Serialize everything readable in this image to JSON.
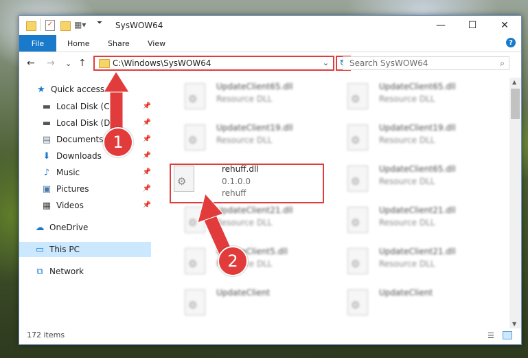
{
  "window": {
    "title": "SysWOW64",
    "minimize_glyph": "—",
    "maximize_glyph": "☐",
    "close_glyph": "✕"
  },
  "ribbon": {
    "file": "File",
    "tabs": [
      "Home",
      "Share",
      "View"
    ],
    "help_glyph": "?"
  },
  "nav": {
    "back_glyph": "←",
    "forward_glyph": "→",
    "recent_glyph": "⌄",
    "up_glyph": "↑",
    "address": "C:\\Windows\\SysWOW64",
    "address_chevron": "⌄",
    "refresh_glyph": "↻",
    "search_placeholder": "Search SysWOW64",
    "search_glyph": "⌕"
  },
  "sidebar": {
    "items": [
      {
        "label": "Quick access",
        "icon": "star-icon",
        "glyph": "★",
        "color": "#1979ca",
        "pinned": false
      },
      {
        "label": "Local Disk (C:)",
        "icon": "drive-icon",
        "glyph": "▬",
        "color": "#555555",
        "pinned": true
      },
      {
        "label": "Local Disk (D:)",
        "icon": "drive-icon",
        "glyph": "▬",
        "color": "#555555",
        "pinned": true
      },
      {
        "label": "Documents",
        "icon": "documents-icon",
        "glyph": "▤",
        "color": "#6b7b8c",
        "pinned": true
      },
      {
        "label": "Downloads",
        "icon": "downloads-icon",
        "glyph": "⬇",
        "color": "#1979ca",
        "pinned": true
      },
      {
        "label": "Music",
        "icon": "music-icon",
        "glyph": "♪",
        "color": "#1979ca",
        "pinned": true
      },
      {
        "label": "Pictures",
        "icon": "pictures-icon",
        "glyph": "▣",
        "color": "#4a7aa8",
        "pinned": true
      },
      {
        "label": "Videos",
        "icon": "videos-icon",
        "glyph": "▦",
        "color": "#444444",
        "pinned": true
      },
      {
        "label": "OneDrive",
        "icon": "onedrive-icon",
        "glyph": "☁",
        "color": "#1979ca",
        "pinned": false
      },
      {
        "label": "This PC",
        "icon": "this-pc-icon",
        "glyph": "▭",
        "color": "#1979ca",
        "pinned": false
      },
      {
        "label": "Network",
        "icon": "network-icon",
        "glyph": "⧉",
        "color": "#1979ca",
        "pinned": false
      }
    ],
    "pin_glyph": "📌"
  },
  "files": [
    {
      "name": "UpdateClient65.dll",
      "desc": "Resource DLL",
      "sub": ""
    },
    {
      "name": "UpdateClient65.dll",
      "desc": "Resource DLL",
      "sub": ""
    },
    {
      "name": "UpdateClient19.dll",
      "desc": "Resource DLL",
      "sub": ""
    },
    {
      "name": "UpdateClient19.dll",
      "desc": "Resource DLL",
      "sub": ""
    },
    {
      "name": "rehuff.dll",
      "desc": "0.1.0.0",
      "sub": "rehuff"
    },
    {
      "name": "UpdateClient65.dll",
      "desc": "Resource DLL",
      "sub": ""
    },
    {
      "name": "UpdateClient21.dll",
      "desc": "Resource DLL",
      "sub": ""
    },
    {
      "name": "UpdateClient21.dll",
      "desc": "Resource DLL",
      "sub": ""
    },
    {
      "name": "UpdateClient5.dll",
      "desc": "Resource DLL",
      "sub": ""
    },
    {
      "name": "UpdateClient21.dll",
      "desc": "Resource DLL",
      "sub": ""
    },
    {
      "name": "UpdateClient",
      "desc": "",
      "sub": ""
    },
    {
      "name": "UpdateClient",
      "desc": "",
      "sub": ""
    }
  ],
  "status": {
    "count": "172 items"
  },
  "annotations": {
    "marker1": "1",
    "marker2": "2",
    "color": "#e23b3b"
  }
}
